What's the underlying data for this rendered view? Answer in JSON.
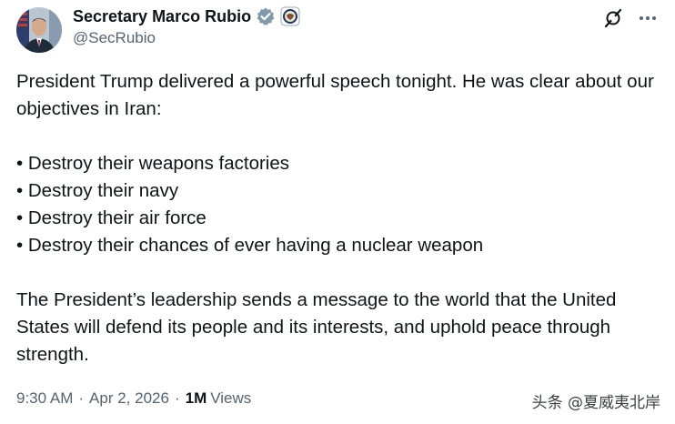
{
  "author": {
    "display_name": "Secretary Marco Rubio",
    "handle": "@SecRubio",
    "verified_badge_icon": "verified-checkmark-icon",
    "affiliation_badge_icon": "us-state-department-seal-icon",
    "verified_color": "#829aab"
  },
  "top_actions": {
    "grok_icon": "grok-icon",
    "more_icon": "more-horizontal-icon"
  },
  "tweet": {
    "intro": "President Trump delivered a powerful speech tonight. He was clear about our objectives in Iran:",
    "bullets": [
      "• Destroy their weapons factories",
      "• Destroy their navy",
      "• Destroy their air force",
      "• Destroy their chances of ever having a nuclear weapon"
    ],
    "closing": "The President’s leadership sends a message to the world that the United States will defend its people and its interests, and uphold peace through strength."
  },
  "meta": {
    "time": "9:30 AM",
    "separator": "·",
    "date": "Apr 2, 2026",
    "views_count": "1M",
    "views_label": "Views"
  },
  "watermark": {
    "text": "头条 @夏威夷北岸"
  },
  "colors": {
    "text_primary": "#0f1419",
    "text_secondary": "#536471",
    "background": "#ffffff"
  }
}
